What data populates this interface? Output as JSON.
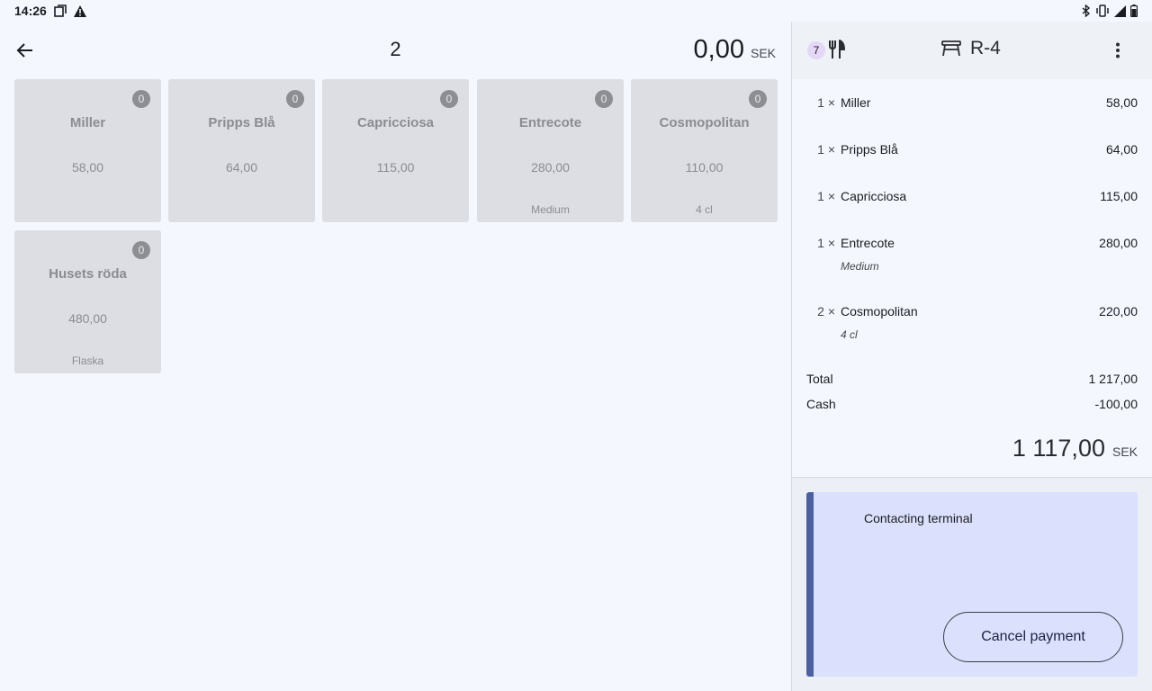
{
  "status_bar": {
    "time": "14:26"
  },
  "left_pane": {
    "guest_count": "2",
    "total_amount": "0,00",
    "currency": "SEK",
    "products": [
      {
        "name": "Miller",
        "price": "58,00",
        "count": "0",
        "variant": ""
      },
      {
        "name": "Pripps Blå",
        "price": "64,00",
        "count": "0",
        "variant": ""
      },
      {
        "name": "Capricciosa",
        "price": "115,00",
        "count": "0",
        "variant": ""
      },
      {
        "name": "Entrecote",
        "price": "280,00",
        "count": "0",
        "variant": "Medium"
      },
      {
        "name": "Cosmopolitan",
        "price": "110,00",
        "count": "0",
        "variant": "4 cl"
      },
      {
        "name": "Husets röda",
        "price": "480,00",
        "count": "0",
        "variant": "Flaska"
      }
    ]
  },
  "right_pane": {
    "course_number": "7",
    "table_name": "R-4",
    "order_lines": [
      {
        "qty": "1 ×",
        "name": "Miller",
        "amount": "58,00",
        "modifier": ""
      },
      {
        "qty": "1 ×",
        "name": "Pripps Blå",
        "amount": "64,00",
        "modifier": ""
      },
      {
        "qty": "1 ×",
        "name": "Capricciosa",
        "amount": "115,00",
        "modifier": ""
      },
      {
        "qty": "1 ×",
        "name": "Entrecote",
        "amount": "280,00",
        "modifier": "Medium"
      },
      {
        "qty": "2 ×",
        "name": "Cosmopolitan",
        "amount": "220,00",
        "modifier": "4 cl"
      }
    ],
    "total_label": "Total",
    "total_value": "1 217,00",
    "cash_label": "Cash",
    "cash_value": "-100,00",
    "grand_total": "1 117,00",
    "currency": "SEK",
    "payment_message": "Contacting terminal",
    "cancel_label": "Cancel payment"
  }
}
